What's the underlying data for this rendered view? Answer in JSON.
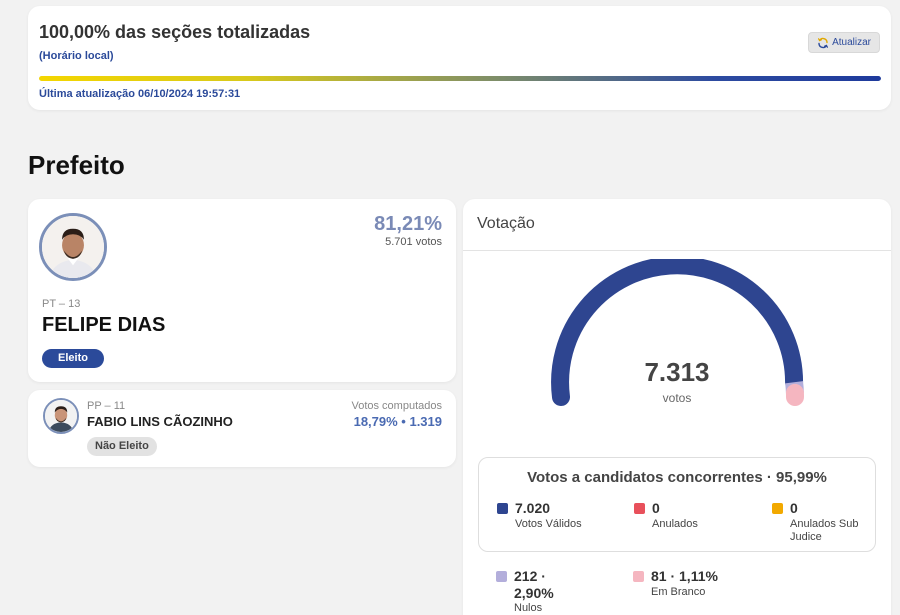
{
  "status": {
    "title": "100,00% das seções totalizadas",
    "subtitle": "(Horário local)",
    "refresh_label": "Atualizar",
    "progress_percent": 100,
    "last_update": "Última atualização 06/10/2024 19:57:31"
  },
  "section_title": "Prefeito",
  "candidates": [
    {
      "party": "PT – 13",
      "name": "FELIPE DIAS",
      "percent": "81,21%",
      "votes": "5.701 votos",
      "status": "Eleito"
    },
    {
      "party": "PP – 11",
      "name": "FABIO LINS CÃOZINHO",
      "votes_label": "Votos computados",
      "stats": "18,79%  •  1.319",
      "status": "Não Eleito"
    }
  ],
  "votacao": {
    "title": "Votação",
    "total": "7.313",
    "total_label": "votos",
    "gauge_share": {
      "validos": 95.99,
      "nulos": 2.9,
      "brancos": 1.11
    },
    "concorrentes_title": "Votos a candidatos concorrentes · 95,99%",
    "legend": [
      {
        "value": "7.020",
        "label": "Votos Válidos",
        "color": "#2e4590"
      },
      {
        "value": "0",
        "label": "Anulados",
        "color": "#e8505b"
      },
      {
        "value": "0",
        "label": "Anulados Sub Judice",
        "color": "#f2a900"
      },
      {
        "value": "212 · 2,90%",
        "label": "Nulos",
        "color": "#b3aedb"
      },
      {
        "value": "81 · 1,11%",
        "label": "Em Branco",
        "color": "#f5b6c0"
      }
    ]
  }
}
